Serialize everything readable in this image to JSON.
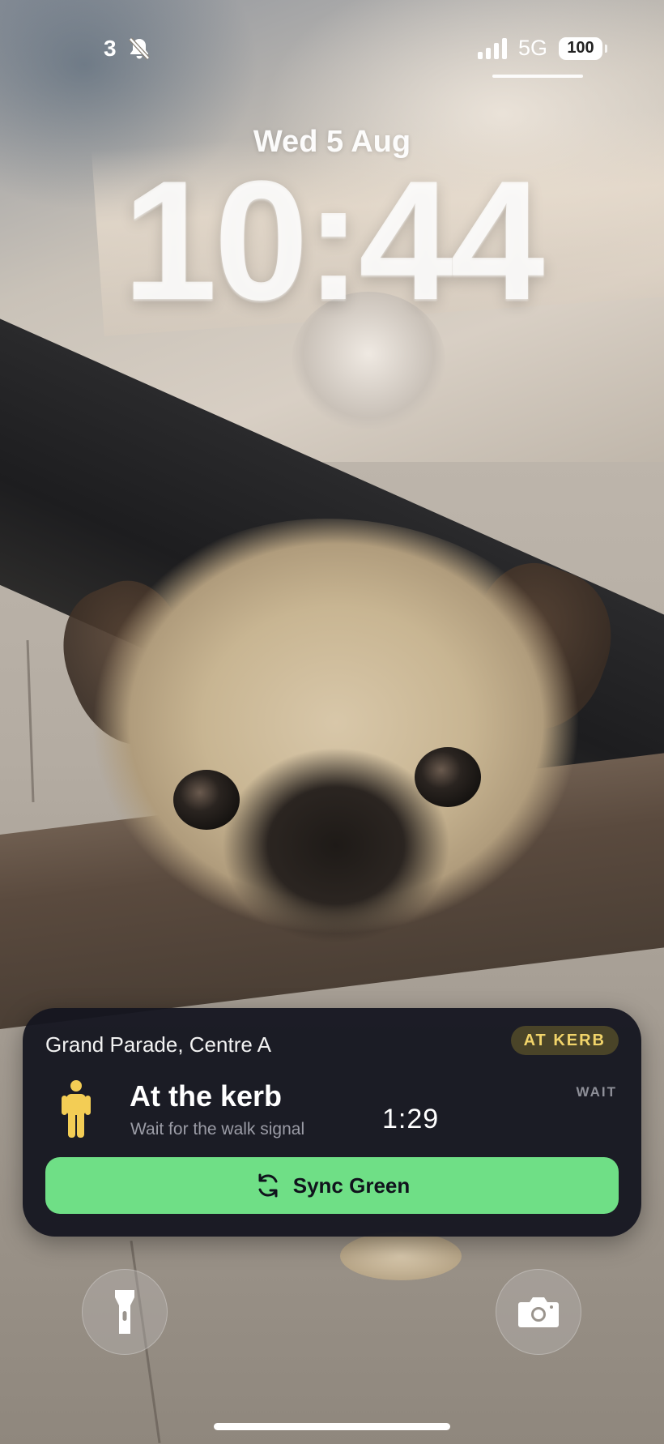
{
  "status_bar": {
    "notification_count": "3",
    "bell_icon": "bell-slash-icon",
    "network": "5G",
    "battery": "100"
  },
  "lock_screen": {
    "date": "Wed 5 Aug",
    "time": "10:44"
  },
  "live_activity": {
    "location": "Grand Parade, Centre A",
    "status_badge": "AT KERB",
    "icon": "pedestrian-icon",
    "headline": "At the kerb",
    "subline": "Wait for the walk signal",
    "timer": "1:29",
    "signal_state": "WAIT",
    "action_button": {
      "label": "Sync Green",
      "icon": "sync-icon"
    },
    "colors": {
      "card_background": "#14151f",
      "badge_text": "#f1d46a",
      "badge_background": "#4a4428",
      "button_background": "#6fdf86",
      "walker": "#f3cd55"
    }
  },
  "quick_actions": {
    "left": "flashlight-icon",
    "right": "camera-icon"
  }
}
